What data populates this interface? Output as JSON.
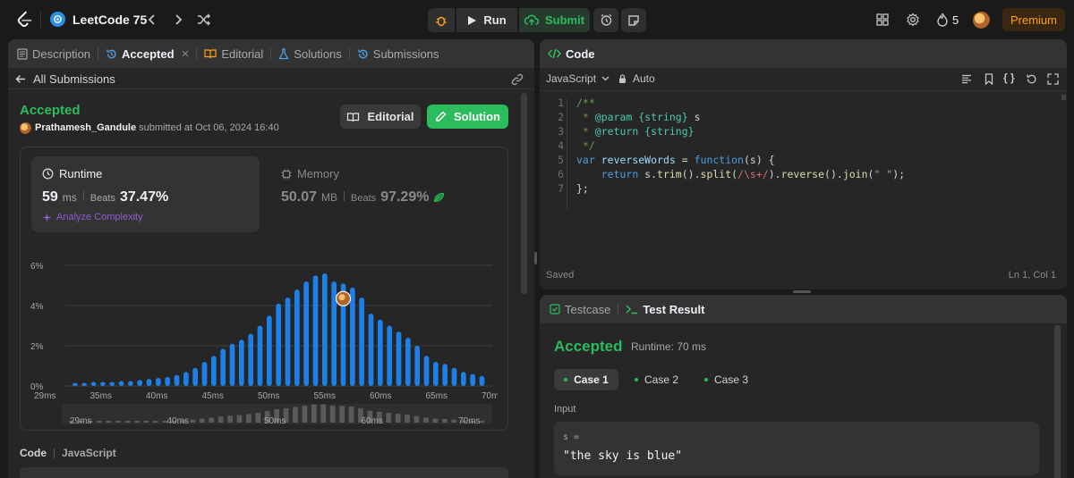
{
  "topbar": {
    "list_title": "LeetCode 75",
    "run_label": "Run",
    "submit_label": "Submit",
    "streak": "5",
    "premium_label": "Premium"
  },
  "left_tabs": [
    "Description",
    "Accepted",
    "Editorial",
    "Solutions",
    "Submissions"
  ],
  "back_link": "All Submissions",
  "submission": {
    "status": "Accepted",
    "user": "Prathamesh_Gandule",
    "submitted_text": "submitted at Oct 06, 2024 16:40",
    "editorial_button": "Editorial",
    "solution_button": "Solution"
  },
  "runtime": {
    "label": "Runtime",
    "value": "59",
    "unit": "ms",
    "beats_label": "Beats",
    "beats": "37.47%",
    "analyze": "Analyze Complexity"
  },
  "memory": {
    "label": "Memory",
    "value": "50.07",
    "unit": "MB",
    "beats_label": "Beats",
    "beats": "97.29%"
  },
  "code_section": {
    "label": "Code",
    "lang": "JavaScript"
  },
  "editor": {
    "title": "Code",
    "language": "JavaScript",
    "mode": "Auto",
    "saved": "Saved",
    "cursor": "Ln 1, Col 1",
    "line_numbers": [
      "1",
      "2",
      "3",
      "4",
      "5",
      "6",
      "7"
    ]
  },
  "console": {
    "testcase_tab": "Testcase",
    "result_tab": "Test Result",
    "status": "Accepted",
    "runtime": "Runtime: 70 ms",
    "cases": [
      "Case 1",
      "Case 2",
      "Case 3"
    ],
    "input_label": "Input",
    "var_label": "s =",
    "var_value": "\"the sky is blue\""
  },
  "colors": {
    "accent_green": "#2cbb5d",
    "bar_blue": "#1d80e8",
    "premium_orange": "#ffa116"
  },
  "chart_data": {
    "type": "bar",
    "ylabel_ticks": [
      "0%",
      "2%",
      "4%",
      "6%"
    ],
    "ylim": [
      0,
      6
    ],
    "xtick_labels": [
      "29ms",
      "35ms",
      "40ms",
      "45ms",
      "50ms",
      "55ms",
      "60ms",
      "65ms",
      "70ms"
    ],
    "nav_tick_labels": [
      "29ms",
      "40ms",
      "50ms",
      "60ms",
      "70ms"
    ],
    "grid": true,
    "highlight_index": 29,
    "values": [
      0.15,
      0.15,
      0.2,
      0.2,
      0.2,
      0.25,
      0.25,
      0.3,
      0.35,
      0.4,
      0.45,
      0.55,
      0.7,
      0.9,
      1.2,
      1.5,
      1.85,
      2.1,
      2.3,
      2.6,
      3.0,
      3.5,
      4.1,
      4.4,
      4.8,
      5.2,
      5.5,
      5.6,
      5.2,
      5.1,
      4.9,
      4.4,
      3.6,
      3.3,
      3.0,
      2.7,
      2.4,
      2.0,
      1.5,
      1.2,
      1.1,
      0.9,
      0.7,
      0.6,
      0.5
    ]
  }
}
